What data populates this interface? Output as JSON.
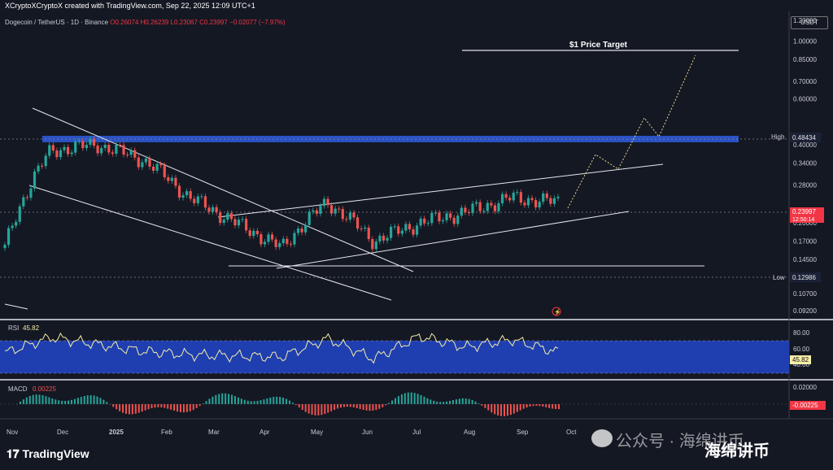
{
  "header": {
    "credit": "XCryptoXCryptoX created with TradingView.com, Sep 22, 2025 12:09 UTC+1",
    "symbol": "Dogecoin / TetherUS · 1D · Binance",
    "ohlc": "O0.26074  H0.26239  L0.23067  C0.23997  −0.02077 (−7.97%)",
    "currency": "USDT"
  },
  "annotations": {
    "target": "$1 Price Target",
    "high_label": "High",
    "high_value": "0.48434",
    "low_label": "Low",
    "low_value": "0.12986",
    "last_price": "0.23997",
    "countdown": "12:50:14"
  },
  "price_axis": {
    "ticks": [
      "1.20000",
      "1.00000",
      "0.85000",
      "0.70000",
      "0.60000",
      "0.40000",
      "0.34000",
      "0.28000",
      "0.20000",
      "0.17000",
      "0.14500",
      "0.10700",
      "0.09200"
    ]
  },
  "rsi": {
    "label": "RSI",
    "value": "45.82",
    "ticks": [
      "80.00",
      "60.00",
      "40.00"
    ]
  },
  "macd": {
    "label": "MACD",
    "value": "0.00225",
    "tick": "0.02000",
    "current": "-0.00225"
  },
  "time_axis": [
    "Nov",
    "Dec",
    "2025",
    "Feb",
    "Mar",
    "Apr",
    "May",
    "Jun",
    "Jul",
    "Aug",
    "Sep",
    "Oct"
  ],
  "footer": {
    "logo": "TradingView",
    "watermark1": "公众号 · 海绵讲币",
    "watermark2": "海绵讲币"
  },
  "chart_data": {
    "type": "candlestick",
    "log_scale": true,
    "ylim": [
      0.085,
      1.3
    ],
    "resistance": 0.48434,
    "support_low": 0.12986,
    "x": [
      "Oct",
      "Nov",
      "Dec",
      "2025",
      "Feb",
      "Mar",
      "Apr",
      "May",
      "Jun",
      "Jul",
      "Aug",
      "Sep",
      "Oct"
    ],
    "close": [
      0.16,
      0.38,
      0.4,
      0.35,
      0.25,
      0.2,
      0.16,
      0.24,
      0.17,
      0.2,
      0.22,
      0.25,
      0.24
    ],
    "projection": [
      0.24,
      0.3,
      0.42,
      0.37,
      0.52,
      0.46,
      1.0
    ],
    "rsi": [
      45,
      72,
      60,
      48,
      42,
      40,
      38,
      70,
      35,
      74,
      55,
      68,
      46
    ],
    "rsi_ylim": [
      0,
      100
    ],
    "colors": {
      "up": "#26a69a",
      "down": "#ef5350",
      "band": "#1e3ea8",
      "rsi_line": "#f3e9a6"
    }
  }
}
